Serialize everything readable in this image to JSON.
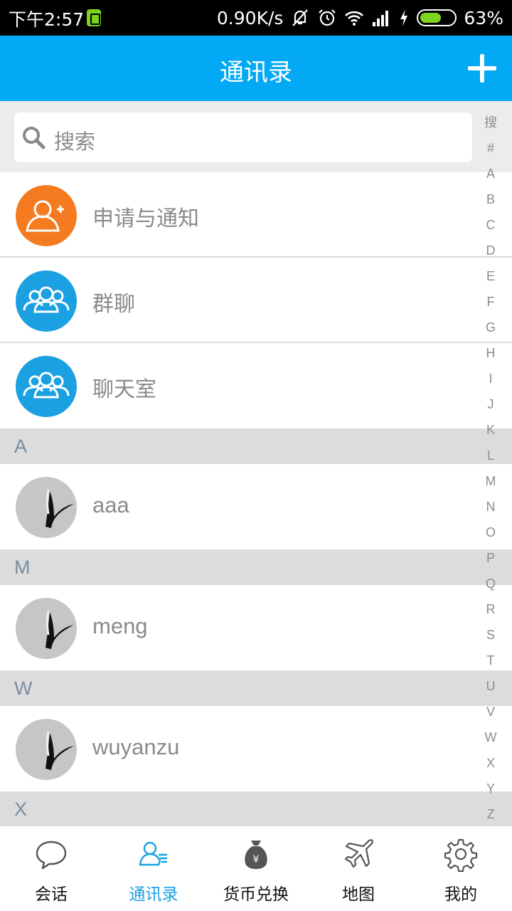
{
  "status_bar": {
    "time": "下午2:57",
    "speed": "0.90K/s",
    "battery": "63%"
  },
  "header": {
    "title": "通讯录",
    "add_icon": "plus-icon"
  },
  "search": {
    "placeholder": "搜索"
  },
  "fixed_items": [
    {
      "label": "申请与通知",
      "icon": "add-user-icon",
      "color": "#f47b20"
    },
    {
      "label": "群聊",
      "icon": "group-icon",
      "color": "#1ba0e2"
    },
    {
      "label": "聊天室",
      "icon": "group-icon",
      "color": "#1ba0e2"
    }
  ],
  "sections": [
    {
      "letter": "A",
      "contacts": [
        "aaa"
      ]
    },
    {
      "letter": "M",
      "contacts": [
        "meng"
      ]
    },
    {
      "letter": "W",
      "contacts": [
        "wuyanzu"
      ]
    },
    {
      "letter": "X",
      "contacts": []
    }
  ],
  "index_letters": [
    "搜",
    "#",
    "A",
    "B",
    "C",
    "D",
    "E",
    "F",
    "G",
    "H",
    "I",
    "J",
    "K",
    "L",
    "M",
    "N",
    "O",
    "P",
    "Q",
    "R",
    "S",
    "T",
    "U",
    "V",
    "W",
    "X",
    "Y",
    "Z"
  ],
  "tabs": [
    {
      "label": "会话",
      "icon": "chat-bubble-icon",
      "active": false
    },
    {
      "label": "通讯录",
      "icon": "contacts-icon",
      "active": true
    },
    {
      "label": "货币兑换",
      "icon": "money-bag-icon",
      "active": false
    },
    {
      "label": "地图",
      "icon": "airplane-icon",
      "active": false
    },
    {
      "label": "我的",
      "icon": "gear-icon",
      "active": false
    }
  ],
  "colors": {
    "primary": "#03a9f4",
    "accent_orange": "#f47b20",
    "accent_blue": "#1ba0e2"
  }
}
